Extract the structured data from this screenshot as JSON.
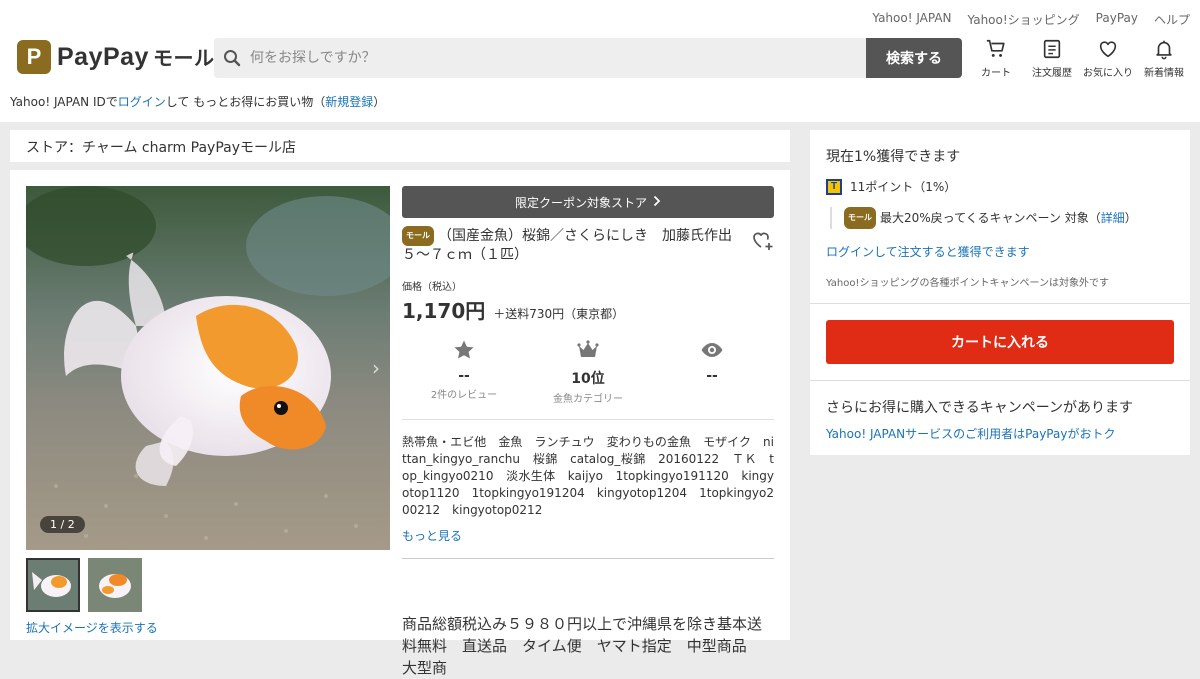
{
  "header": {
    "util_links": [
      "Yahoo! JAPAN",
      "Yahoo!ショッピング",
      "PayPay",
      "ヘルプ"
    ],
    "logo": {
      "mark": "P",
      "text": "PayPay",
      "mall": "モール"
    },
    "search": {
      "placeholder": "何をお探しですか？",
      "button": "検索する"
    },
    "icons": [
      {
        "name": "cart-icon",
        "label": "カート"
      },
      {
        "name": "order-history-icon",
        "label": "注文履歴"
      },
      {
        "name": "favorites-icon",
        "label": "お気に入り"
      },
      {
        "name": "bell-icon",
        "label": "新着情報"
      }
    ],
    "login": {
      "prefix": "Yahoo! JAPAN IDで",
      "login_link": "ログイン",
      "middle": "して もっとお得にお買い物（",
      "register_link": "新規登録",
      "suffix": "）"
    }
  },
  "store": {
    "label": "ストア：チャーム charm PayPayモール店"
  },
  "product": {
    "image_counter": "1 / 2",
    "zoom_link": "拡大イメージを表示する",
    "coupon": "限定クーポン対象ストア",
    "badge": "モール",
    "title": "（国産金魚）桜錦／さくらにしき　加藤氏作出　５〜７ｃｍ（１匹）",
    "price_label": "価格（税込）",
    "price": "1,170円",
    "shipping": "＋送料730円（東京都）",
    "stats": [
      {
        "icon": "star-icon",
        "value": "--",
        "sub": "2件のレビュー"
      },
      {
        "icon": "crown-icon",
        "value": "10位",
        "sub": "金魚カテゴリー"
      },
      {
        "icon": "eye-icon",
        "value": "--",
        "sub": ""
      }
    ],
    "tags": "熱帯魚・エビ他　金魚　ランチュウ　変わりもの金魚　モザイク　nittan_kingyo_ranchu　桜錦　catalog_桜錦　20160122　ＴＫ　top_kingyo0210　淡水生体　kaijyo　1topkingyo191120　kingyotop1120　1topkingyo191204　kingyotop1204　1topkingyo200212　kingyotop0212",
    "more": "もっと見る",
    "description": "商品総額税込み５９８０円以上で沖縄県を除き基本送料無料　直送品　タイム便　ヤマト指定　中型商品　大型商"
  },
  "side": {
    "points_heading": "現在1%獲得できます",
    "tpoint": "11ポイント（1%）",
    "campaign_badge": "モール",
    "campaign_text": "最大20%戻ってくるキャンペーン 対象（",
    "campaign_link": "詳細",
    "campaign_end": "）",
    "login_link": "ログインして注文すると獲得できます",
    "note": "Yahoo!ショッピングの各種ポイントキャンペーンは対象外です",
    "cart_button": "カートに入れる",
    "more_heading": "さらにお得に購入できるキャンペーンがあります",
    "more_link": "Yahoo! JAPANサービスのご利用者はPayPayがおトク"
  },
  "colors": {
    "brand": "#8a6b1f",
    "link": "#1a73b8",
    "cart": "#e02b15",
    "dark_button": "#555555"
  }
}
